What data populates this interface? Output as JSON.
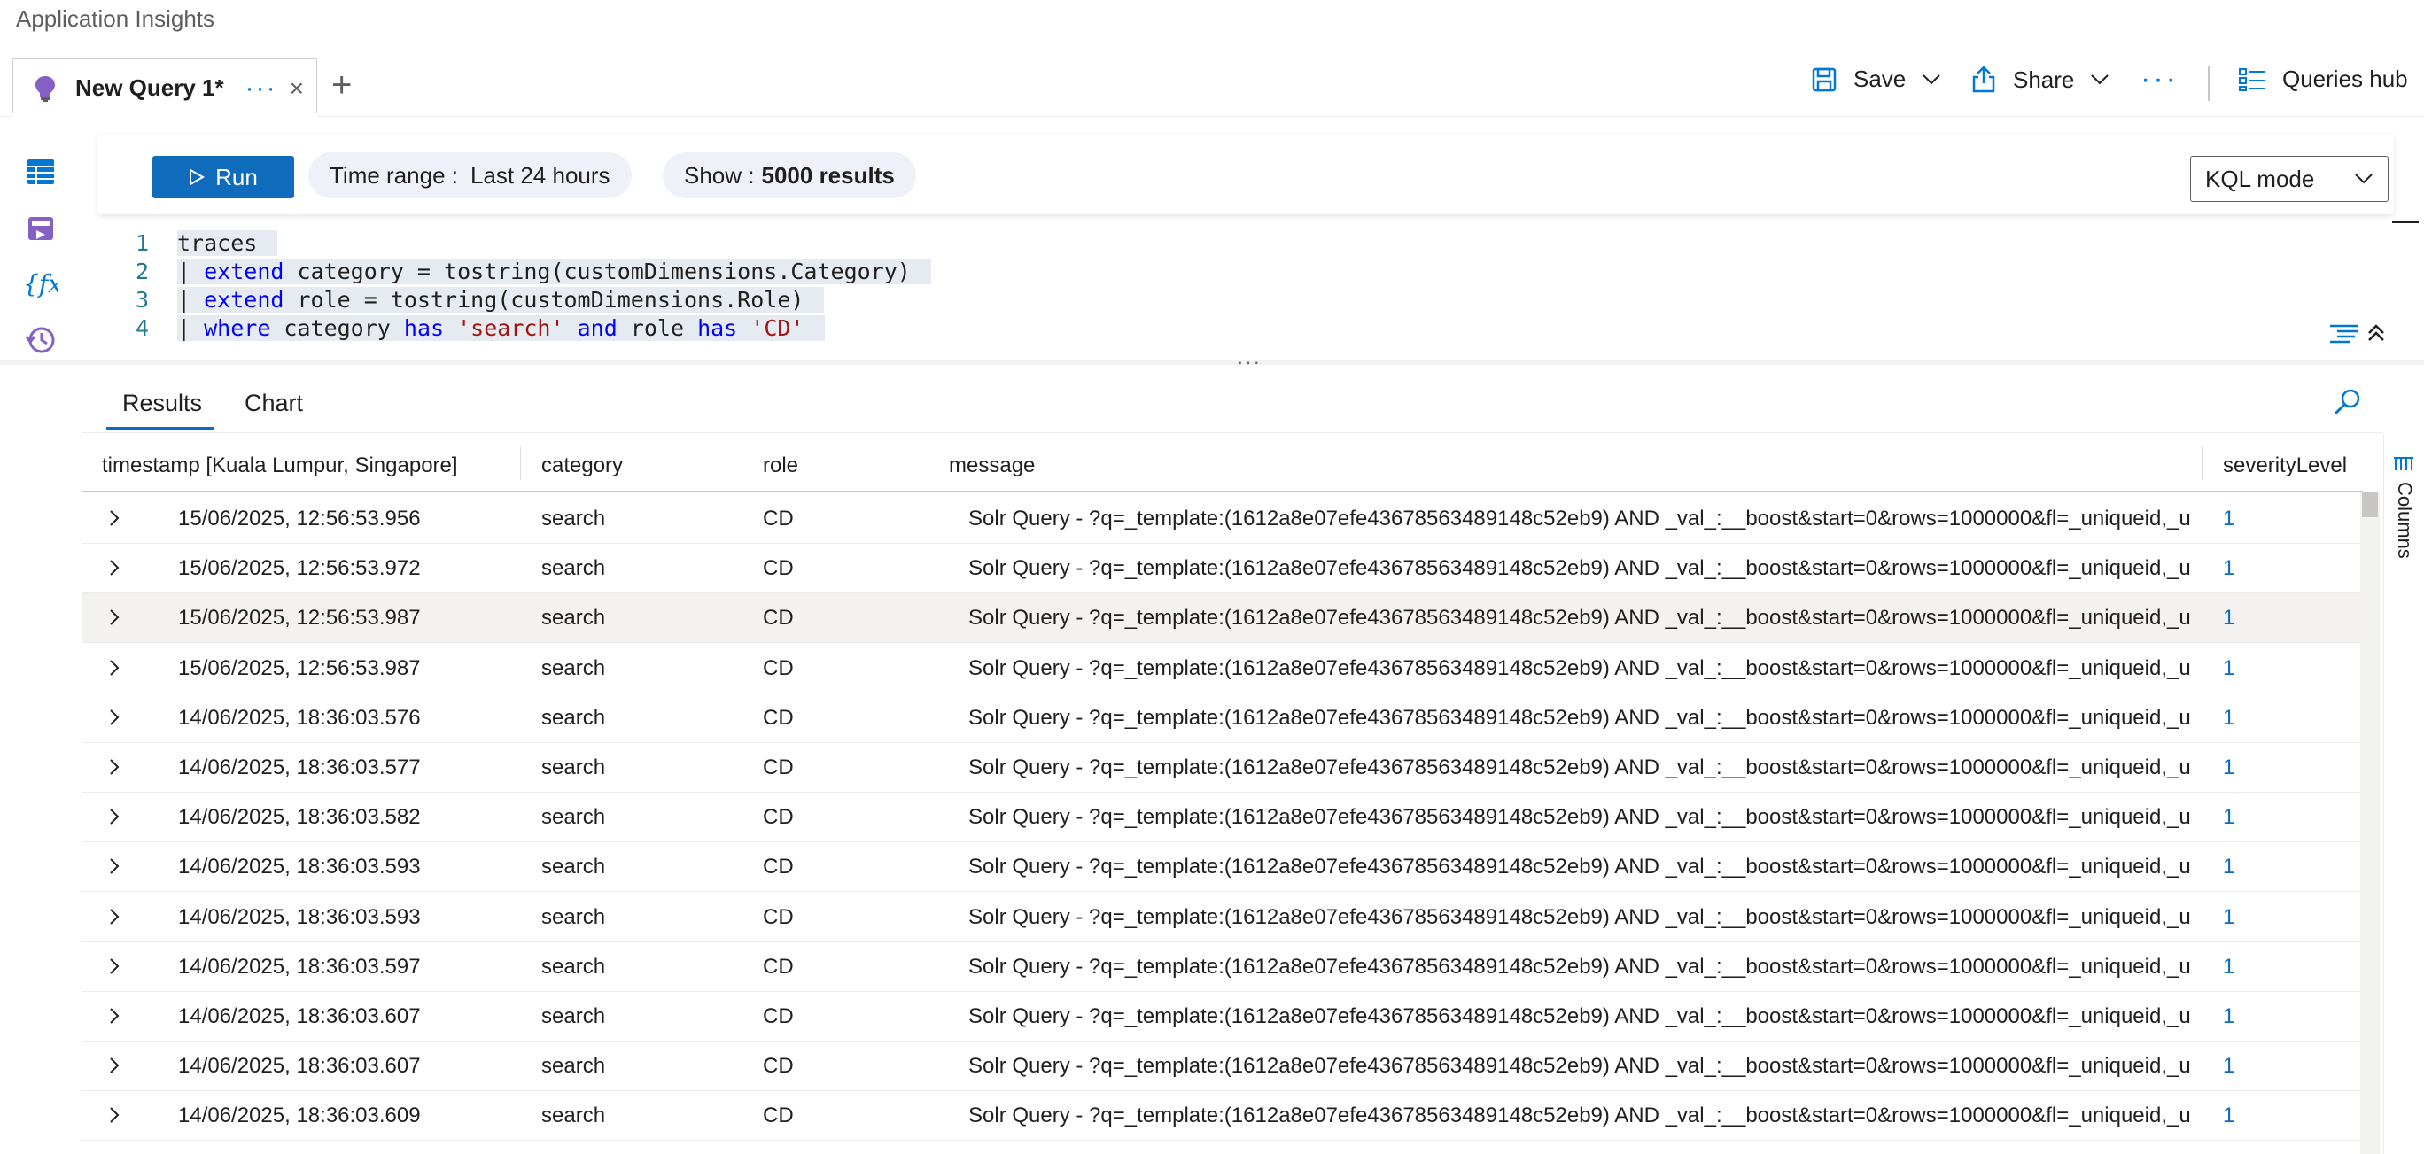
{
  "app": {
    "title": "Application Insights"
  },
  "tab": {
    "label": "New Query 1*",
    "more": "···",
    "close": "×",
    "add": "+"
  },
  "commands": {
    "save": "Save",
    "share": "Share",
    "more": "···",
    "queries_hub": "Queries hub"
  },
  "toolbar": {
    "run": "Run",
    "time_range_label": "Time range :",
    "time_range_value": "Last 24 hours",
    "show_label": "Show :",
    "show_value": "5000 results",
    "mode": "KQL mode"
  },
  "editor": {
    "line_numbers": [
      "1",
      "2",
      "3",
      "4"
    ],
    "lines": [
      "traces",
      "| extend category = tostring(customDimensions.Category)",
      "| extend role = tostring(customDimensions.Role)",
      "| where category has 'search' and role has 'CD'"
    ]
  },
  "results_tabs": [
    "Results",
    "Chart"
  ],
  "columns_panel_label": "Columns",
  "splitter": "···",
  "grid": {
    "headers": [
      "timestamp [Kuala Lumpur, Singapore]",
      "category",
      "role",
      "message",
      "severityLevel"
    ],
    "rows": [
      [
        "15/06/2025, 12:56:53.956",
        "search",
        "CD",
        "Solr Query - ?q=_template:(1612a8e07efe43678563489148c52eb9) AND _val_:__boost&start=0&rows=1000000&fl=_uniqueid,_u...",
        "1"
      ],
      [
        "15/06/2025, 12:56:53.972",
        "search",
        "CD",
        "Solr Query - ?q=_template:(1612a8e07efe43678563489148c52eb9) AND _val_:__boost&start=0&rows=1000000&fl=_uniqueid,_u...",
        "1"
      ],
      [
        "15/06/2025, 12:56:53.987",
        "search",
        "CD",
        "Solr Query - ?q=_template:(1612a8e07efe43678563489148c52eb9) AND _val_:__boost&start=0&rows=1000000&fl=_uniqueid,_u...",
        "1"
      ],
      [
        "15/06/2025, 12:56:53.987",
        "search",
        "CD",
        "Solr Query - ?q=_template:(1612a8e07efe43678563489148c52eb9) AND _val_:__boost&start=0&rows=1000000&fl=_uniqueid,_u...",
        "1"
      ],
      [
        "14/06/2025, 18:36:03.576",
        "search",
        "CD",
        "Solr Query - ?q=_template:(1612a8e07efe43678563489148c52eb9) AND _val_:__boost&start=0&rows=1000000&fl=_uniqueid,_u...",
        "1"
      ],
      [
        "14/06/2025, 18:36:03.577",
        "search",
        "CD",
        "Solr Query - ?q=_template:(1612a8e07efe43678563489148c52eb9) AND _val_:__boost&start=0&rows=1000000&fl=_uniqueid,_u...",
        "1"
      ],
      [
        "14/06/2025, 18:36:03.582",
        "search",
        "CD",
        "Solr Query - ?q=_template:(1612a8e07efe43678563489148c52eb9) AND _val_:__boost&start=0&rows=1000000&fl=_uniqueid,_u...",
        "1"
      ],
      [
        "14/06/2025, 18:36:03.593",
        "search",
        "CD",
        "Solr Query - ?q=_template:(1612a8e07efe43678563489148c52eb9) AND _val_:__boost&start=0&rows=1000000&fl=_uniqueid,_u...",
        "1"
      ],
      [
        "14/06/2025, 18:36:03.593",
        "search",
        "CD",
        "Solr Query - ?q=_template:(1612a8e07efe43678563489148c52eb9) AND _val_:__boost&start=0&rows=1000000&fl=_uniqueid,_u...",
        "1"
      ],
      [
        "14/06/2025, 18:36:03.597",
        "search",
        "CD",
        "Solr Query - ?q=_template:(1612a8e07efe43678563489148c52eb9) AND _val_:__boost&start=0&rows=1000000&fl=_uniqueid,_u...",
        "1"
      ],
      [
        "14/06/2025, 18:36:03.607",
        "search",
        "CD",
        "Solr Query - ?q=_template:(1612a8e07efe43678563489148c52eb9) AND _val_:__boost&start=0&rows=1000000&fl=_uniqueid,_u...",
        "1"
      ],
      [
        "14/06/2025, 18:36:03.607",
        "search",
        "CD",
        "Solr Query - ?q=_template:(1612a8e07efe43678563489148c52eb9) AND _val_:__boost&start=0&rows=1000000&fl=_uniqueid,_u...",
        "1"
      ],
      [
        "14/06/2025, 18:36:03.609",
        "search",
        "CD",
        "Solr Query - ?q=_template:(1612a8e07efe43678563489148c52eb9) AND _val_:__boost&start=0&rows=1000000&fl=_uniqueid,_u...",
        "1"
      ]
    ],
    "selected_row_index": 2
  },
  "icons": {
    "tab": "lightbulb-icon",
    "save": "save-icon",
    "share": "share-icon",
    "queries_hub": "queries-hub-icon",
    "rail": [
      "tables-icon",
      "queries-icon",
      "functions-icon",
      "history-icon"
    ],
    "run": "play-icon",
    "search": "search-icon",
    "expand": "chevron-right-icon"
  },
  "colors": {
    "accent": "#0f6cbd",
    "selected_row": "#f3f2f1",
    "keyword": "#0000ff",
    "string": "#a31515"
  }
}
